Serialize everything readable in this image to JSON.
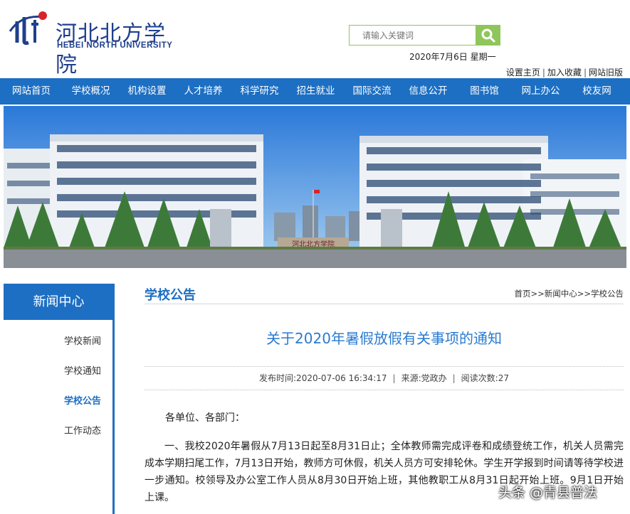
{
  "header": {
    "logo_cn": "河北北方学院",
    "logo_en": "HEBEI NORTH UNIVERSITY",
    "search_placeholder": "请输入关键词",
    "date": "2020年7月6日 星期一",
    "links": [
      "设置主页",
      "加入收藏",
      "网站旧版"
    ]
  },
  "nav": {
    "items": [
      "网站首页",
      "学校概况",
      "机构设置",
      "人才培养",
      "科学研究",
      "招生就业",
      "国际交流",
      "信息公开",
      "图书馆",
      "网上办公",
      "校友网"
    ]
  },
  "banner": {
    "gate_text": "河北北方学院"
  },
  "sidebar": {
    "title": "新闻中心",
    "items": [
      {
        "label": "学校新闻",
        "active": false
      },
      {
        "label": "学校通知",
        "active": false
      },
      {
        "label": "学校公告",
        "active": true
      },
      {
        "label": "工作动态",
        "active": false
      }
    ]
  },
  "content": {
    "section_title": "学校公告",
    "breadcrumb": "首页>>新闻中心>>学校公告",
    "article_title": "关于2020年暑假放假有关事项的通知",
    "meta": {
      "published": "发布时间:2020-07-06 16:34:17",
      "source": "来源:党政办",
      "views": "阅读次数:27"
    },
    "greeting": "各单位、各部门：",
    "paragraph": "一、我校2020年暑假从7月13日起至8月31日止；全体教师需完成评卷和成绩登统工作，机关人员需完成本学期扫尾工作，7月13日开始，教师方可休假，机关人员方可安排轮休。学生开学报到时间请等待学校进一步通知。校领导及办公室工作人员从8月30日开始上班，其他教职工从8月31日起开始上班。9月1日开始上课。"
  },
  "watermark": "头条 @青县普法",
  "colors": {
    "brand_blue": "#1d6fc3",
    "title_blue": "#2a7bd0",
    "search_green": "#8fc65b"
  }
}
